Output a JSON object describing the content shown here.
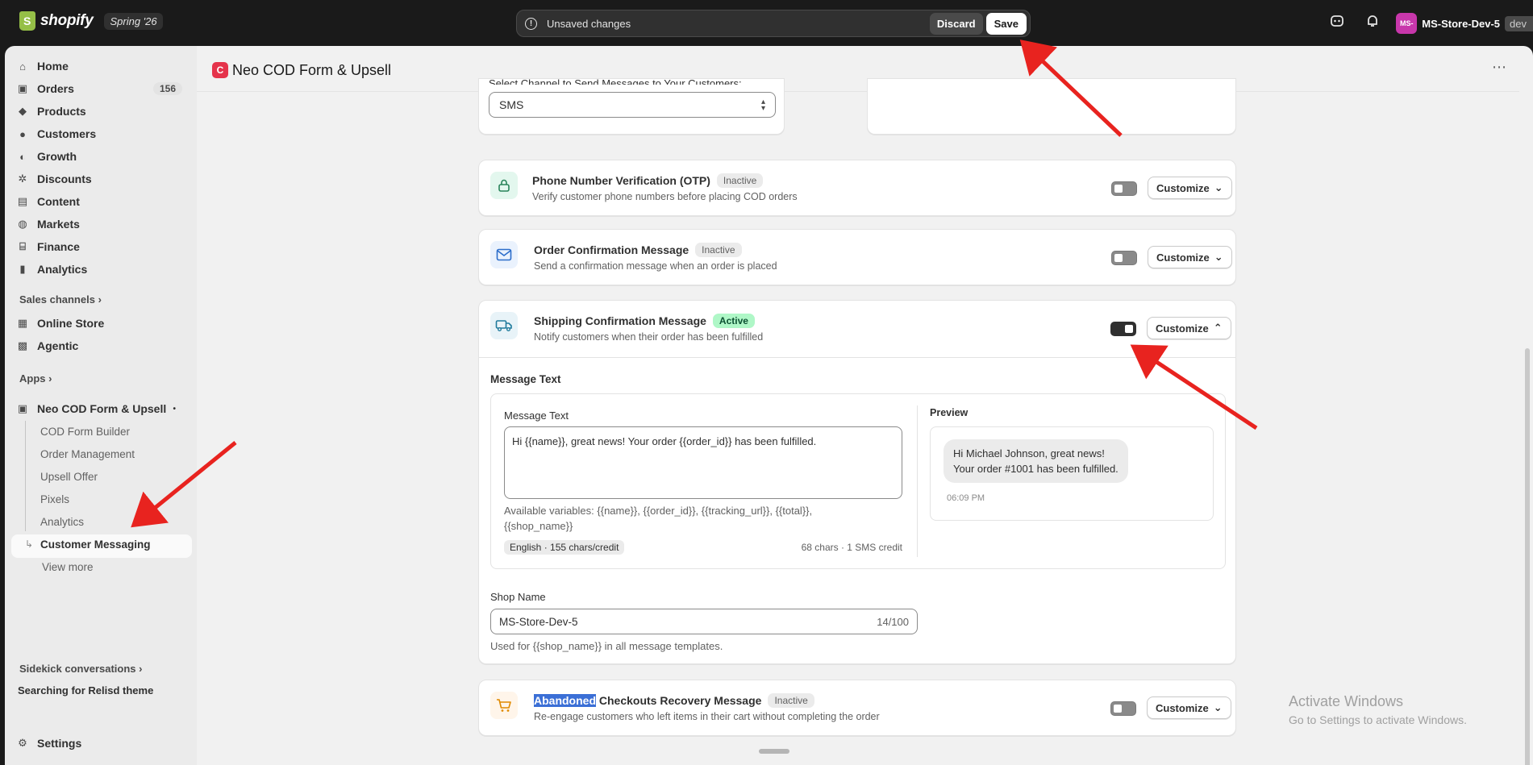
{
  "topbar": {
    "logo_text": "shopify",
    "edition_badge": "Spring '26",
    "unsaved_text": "Unsaved changes",
    "discard_label": "Discard",
    "save_label": "Save",
    "store_avatar": "MS-",
    "store_name": "MS-Store-Dev-5",
    "store_tag": "dev"
  },
  "sidebar": {
    "items": [
      {
        "label": "Home",
        "icon": "home-icon"
      },
      {
        "label": "Orders",
        "icon": "orders-icon",
        "count": "156"
      },
      {
        "label": "Products",
        "icon": "tag-icon"
      },
      {
        "label": "Customers",
        "icon": "person-icon"
      },
      {
        "label": "Growth",
        "icon": "growth-icon"
      },
      {
        "label": "Discounts",
        "icon": "discount-icon"
      },
      {
        "label": "Content",
        "icon": "content-icon"
      },
      {
        "label": "Markets",
        "icon": "globe-icon"
      },
      {
        "label": "Finance",
        "icon": "bank-icon"
      },
      {
        "label": "Analytics",
        "icon": "chart-icon"
      }
    ],
    "sales_channels_label": "Sales channels",
    "channels": [
      {
        "label": "Online Store",
        "icon": "store-icon"
      },
      {
        "label": "Agentic",
        "icon": "agentic-icon"
      }
    ],
    "apps_label": "Apps",
    "app_name": "Neo COD Form & Upsell",
    "app_subitems": [
      "COD Form Builder",
      "Order Management",
      "Upsell Offer",
      "Pixels",
      "Analytics",
      "Customer Messaging"
    ],
    "view_more": "View more",
    "sidekick_label": "Sidekick conversations",
    "sidekick_item": "Searching for Relisd theme",
    "settings_label": "Settings"
  },
  "main": {
    "app_title": "Neo COD Form & Upsell",
    "app_icon_letter": "C",
    "channel_label": "Select Channel to Send Messages to Your Customers:",
    "channel_value": "SMS",
    "rows": [
      {
        "title": "Phone Number Verification (OTP)",
        "badge": "Inactive",
        "desc": "Verify customer phone numbers before placing COD orders",
        "icon": "lock-icon",
        "active": false
      },
      {
        "title": "Order Confirmation Message",
        "badge": "Inactive",
        "desc": "Send a confirmation message when an order is placed",
        "icon": "mail-icon",
        "active": false
      },
      {
        "title": "Shipping Confirmation Message",
        "badge": "Active",
        "desc": "Notify customers when their order has been fulfilled",
        "icon": "truck-icon",
        "active": true
      },
      {
        "title_highlight": "Abandoned",
        "title_rest": " Checkouts Recovery Message",
        "badge": "Inactive",
        "desc": "Re-engage customers who left items in their cart without completing the order",
        "icon": "cart-icon",
        "active": false
      }
    ],
    "customize_label": "Customize",
    "message_section_title": "Message Text",
    "message_field_label": "Message Text",
    "message_value": "Hi {{name}}, great news! Your order {{order_id}} has been fulfilled.",
    "variables_line1": "Available variables: {{name}}, {{order_id}}, {{tracking_url}}, {{total}},",
    "variables_line2": "{{shop_name}}",
    "lang_chip": "English · 155 chars/credit",
    "char_count": "68 chars · 1 SMS credit",
    "preview_label": "Preview",
    "preview_line1": "Hi Michael Johnson, great news!",
    "preview_line2": "Your order #1001 has been fulfilled.",
    "preview_time": "06:09 PM",
    "shop_name_label": "Shop Name",
    "shop_name_value": "MS-Store-Dev-5",
    "shop_name_count": "14/100",
    "shop_name_help": "Used for {{shop_name}} in all message templates."
  },
  "watermark": {
    "line1": "Activate Windows",
    "line2": "Go to Settings to activate Windows."
  },
  "colors": {
    "accent_active": "#aff7c7",
    "arrow": "#e8231f",
    "brand_green": "#95bf47"
  }
}
